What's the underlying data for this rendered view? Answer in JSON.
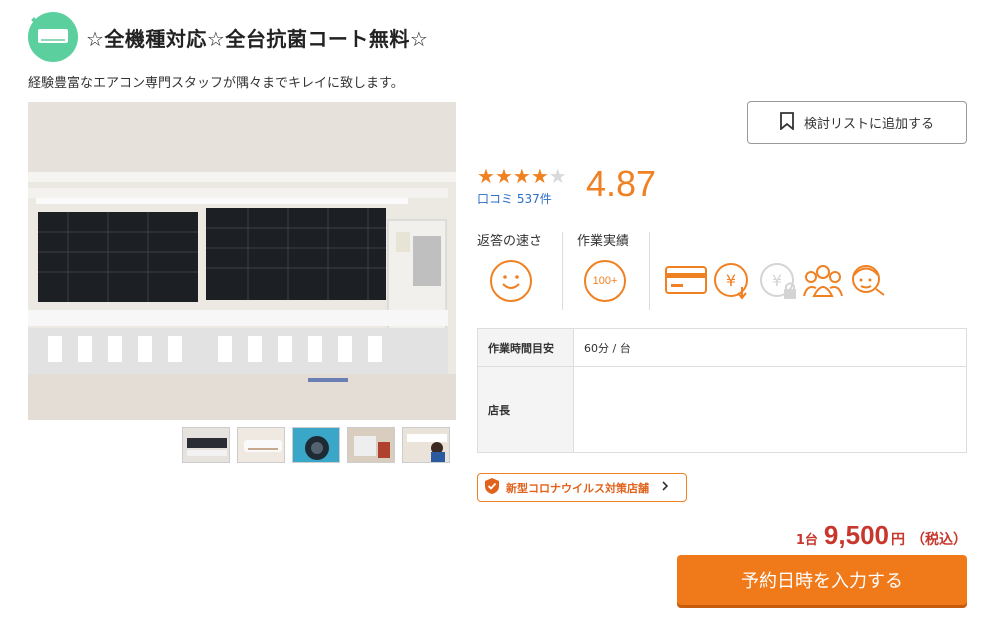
{
  "shop": {
    "title": "☆全機種対応☆全台抗菌コート無料☆",
    "subtitle": "経験豊富なエアコン専門スタッフが隅々までキレイに致します。",
    "category_icon": "air-conditioner-icon"
  },
  "actions": {
    "wishlist_label": "検討リストに追加する",
    "reserve_label": "予約日時を入力する"
  },
  "rating": {
    "stars": 4,
    "max_stars": 5,
    "score": "4.87",
    "reviews_label": "口コミ 537件"
  },
  "metrics": {
    "response_label": "返答の速さ",
    "results_label": "作業実績",
    "results_badge": "100+"
  },
  "features": [
    {
      "icon": "credit-card-icon"
    },
    {
      "icon": "cash-payment-icon"
    },
    {
      "icon": "locked-payment-icon"
    },
    {
      "icon": "group-icon"
    },
    {
      "icon": "staff-icon"
    }
  ],
  "info": {
    "rows": [
      {
        "label": "作業時間目安",
        "value": "60分 / 台"
      },
      {
        "label": "店長",
        "value": ""
      }
    ]
  },
  "badge": {
    "label": "新型コロナウイルス対策店舗"
  },
  "price": {
    "unit": "1台",
    "value": "9,500",
    "currency": "円",
    "tax": "（税込）"
  },
  "colors": {
    "accent": "#f08122",
    "price": "#c8372d",
    "link": "#2a6fc5",
    "category": "#5ccf9e"
  }
}
